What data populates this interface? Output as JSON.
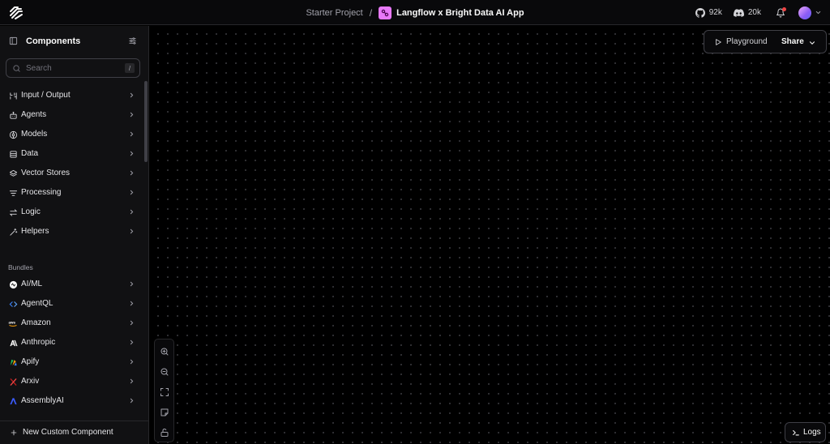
{
  "header": {
    "project": "Starter Project",
    "separator": "/",
    "flow_name": "Langflow x Bright Data AI App",
    "github_count": "92k",
    "discord_count": "20k",
    "colors": {
      "flow_icon": "#e879f9",
      "notification_dot": "#ef4444"
    }
  },
  "sidebar": {
    "title": "Components",
    "search_placeholder": "Search",
    "search_shortcut": "/",
    "categories": [
      {
        "label": "Input / Output",
        "icon": "input-output-icon"
      },
      {
        "label": "Agents",
        "icon": "bot-icon"
      },
      {
        "label": "Models",
        "icon": "brain-icon"
      },
      {
        "label": "Data",
        "icon": "database-icon"
      },
      {
        "label": "Vector Stores",
        "icon": "layers-icon"
      },
      {
        "label": "Processing",
        "icon": "list-filter-icon"
      },
      {
        "label": "Logic",
        "icon": "arrows-icon"
      },
      {
        "label": "Helpers",
        "icon": "wand-icon"
      }
    ],
    "bundles_title": "Bundles",
    "bundles": [
      {
        "label": "AI/ML",
        "icon": "aiml-icon"
      },
      {
        "label": "AgentQL",
        "icon": "agentql-icon"
      },
      {
        "label": "Amazon",
        "icon": "aws-icon"
      },
      {
        "label": "Anthropic",
        "icon": "anthropic-icon"
      },
      {
        "label": "Apify",
        "icon": "apify-icon"
      },
      {
        "label": "Arxiv",
        "icon": "arxiv-icon"
      },
      {
        "label": "AssemblyAI",
        "icon": "assemblyai-icon"
      }
    ],
    "footer_label": "New Custom Component"
  },
  "canvas": {
    "playground_label": "Playground",
    "share_label": "Share",
    "logs_label": "Logs",
    "controls": [
      "zoom-in-icon",
      "zoom-out-icon",
      "fit-view-icon",
      "sticky-note-icon",
      "unlock-icon"
    ]
  }
}
